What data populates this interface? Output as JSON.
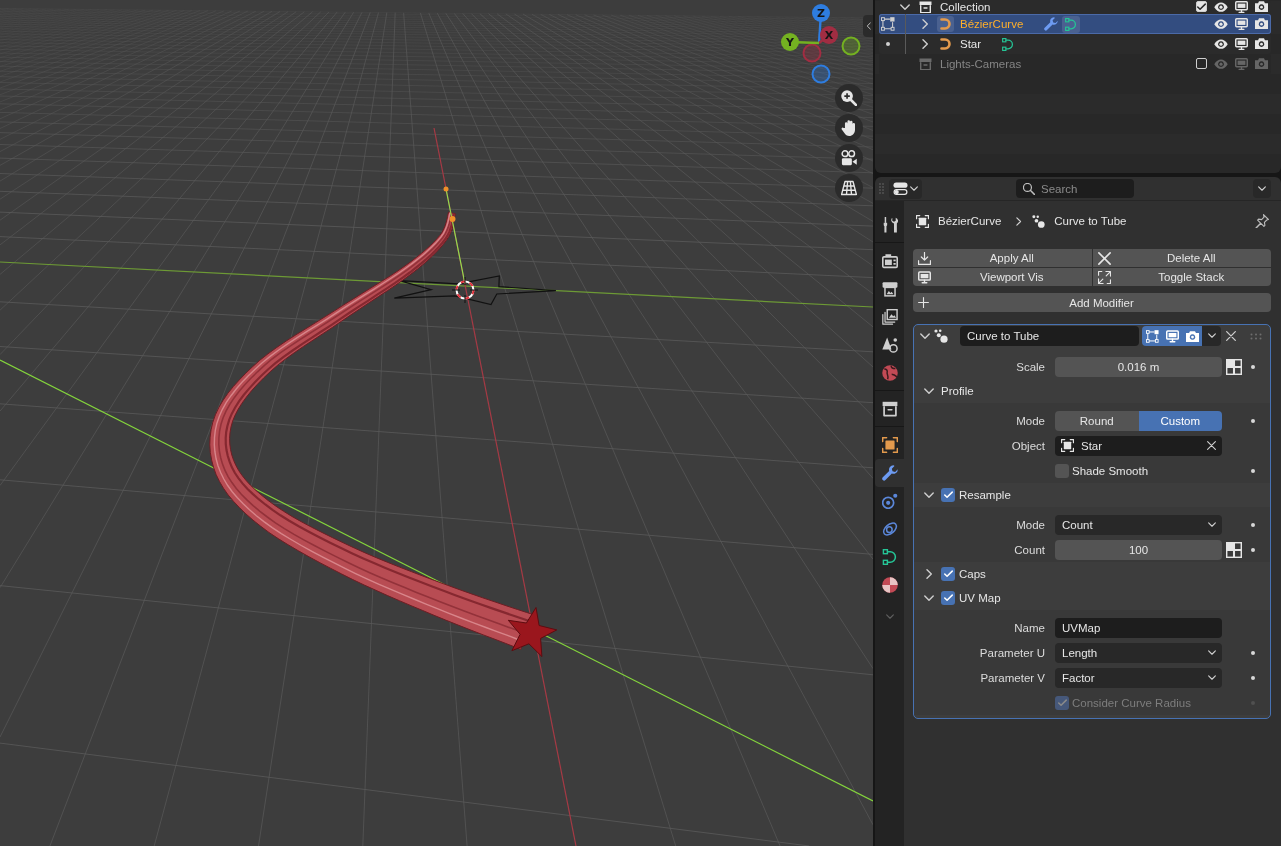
{
  "viewport": {
    "gizmo": {
      "axes": [
        {
          "label": "Z",
          "color": "#2e7de0"
        },
        {
          "label": "X",
          "color": "#a12d42"
        },
        {
          "label": "Y",
          "color": "#74b121"
        }
      ]
    }
  },
  "outliner": {
    "items": [
      {
        "kind": "collection",
        "name": "Collection",
        "selected": false,
        "expanded": true,
        "included": true,
        "children": [
          {
            "kind": "object",
            "name": "BézierCurve",
            "selected": true,
            "expanded": false,
            "edit_mode": true,
            "modifiers": true
          },
          {
            "kind": "object",
            "name": "Star",
            "selected": false,
            "expanded": false,
            "edit_mode": false,
            "modifiers": false
          }
        ]
      },
      {
        "kind": "collection",
        "name": "Lights-Cameras",
        "selected": false,
        "included": false
      }
    ]
  },
  "properties": {
    "search": {
      "placeholder": "Search"
    },
    "tab_groups": [
      {
        "tabs": [
          {
            "kind": "tool",
            "selected": false
          }
        ]
      },
      {
        "tabs": [
          {
            "kind": "render",
            "selected": false
          },
          {
            "kind": "output",
            "selected": false
          },
          {
            "kind": "view_layer",
            "selected": false
          },
          {
            "kind": "scene",
            "selected": false
          },
          {
            "kind": "world",
            "selected": false
          }
        ]
      },
      {
        "tabs": [
          {
            "kind": "collection",
            "selected": false
          }
        ]
      },
      {
        "tabs": [
          {
            "kind": "object",
            "selected": false
          },
          {
            "kind": "modifiers",
            "selected": true
          },
          {
            "kind": "particles",
            "selected": false
          },
          {
            "kind": "physics",
            "selected": false
          },
          {
            "kind": "data",
            "selected": false
          },
          {
            "kind": "material",
            "selected": false
          }
        ]
      }
    ],
    "breadcrumb": {
      "object": "BézierCurve",
      "modifier": "Curve to Tube"
    },
    "stack_buttons": [
      {
        "kind": "apply",
        "label": "Apply All"
      },
      {
        "kind": "delete",
        "label": "Delete All"
      },
      {
        "kind": "visibility",
        "label": "Viewport Vis"
      },
      {
        "kind": "toggle",
        "label": "Toggle Stack"
      }
    ],
    "add_button": {
      "label": "Add Modifier"
    },
    "modifier": {
      "name": "Curve to Tube",
      "expanded": true,
      "active": true,
      "toggles": [
        {
          "kind": "editmode",
          "on": true
        },
        {
          "kind": "viewport",
          "on": true
        },
        {
          "kind": "render",
          "on": true
        }
      ],
      "rows": [
        {
          "kind": "number",
          "label": "Scale",
          "value": "0.016 m",
          "keyframe_dot": true,
          "disabled": false
        }
      ],
      "subpanels": [
        {
          "label": "Profile",
          "expanded": true,
          "rows": [
            {
              "kind": "segmented",
              "label": "Mode",
              "options": [
                {
                  "label": "Round",
                  "selected": false
                },
                {
                  "label": "Custom",
                  "selected": true
                }
              ],
              "keyframe_dot": true,
              "disabled": false
            },
            {
              "kind": "object",
              "label": "Object",
              "value": "Star",
              "keyframe_dot": false,
              "disabled": false
            },
            {
              "kind": "checkbox",
              "label": "Shade Smooth",
              "checked": false,
              "keyframe_dot": true,
              "disabled": false
            }
          ]
        },
        {
          "label": "Resample",
          "expanded": true,
          "enabled": true,
          "rows": [
            {
              "kind": "dropdown",
              "label": "Mode",
              "value": "Count",
              "keyframe_dot": true,
              "disabled": false
            },
            {
              "kind": "number",
              "label": "Count",
              "value": "100",
              "keyframe_dot": true,
              "disabled": false
            }
          ]
        },
        {
          "label": "Caps",
          "expanded": false,
          "enabled": true
        },
        {
          "label": "UV Map",
          "expanded": true,
          "enabled": true,
          "rows": [
            {
              "kind": "text",
              "label": "Name",
              "value": "UVMap",
              "keyframe_dot": false,
              "disabled": false
            },
            {
              "kind": "dropdown",
              "label": "Parameter U",
              "value": "Length",
              "keyframe_dot": true,
              "disabled": false
            },
            {
              "kind": "dropdown",
              "label": "Parameter V",
              "value": "Factor",
              "keyframe_dot": true,
              "disabled": false
            },
            {
              "kind": "checkbox",
              "label": "Consider Curve Radius",
              "checked": true,
              "keyframe_dot": true,
              "disabled": true
            }
          ]
        }
      ]
    }
  }
}
